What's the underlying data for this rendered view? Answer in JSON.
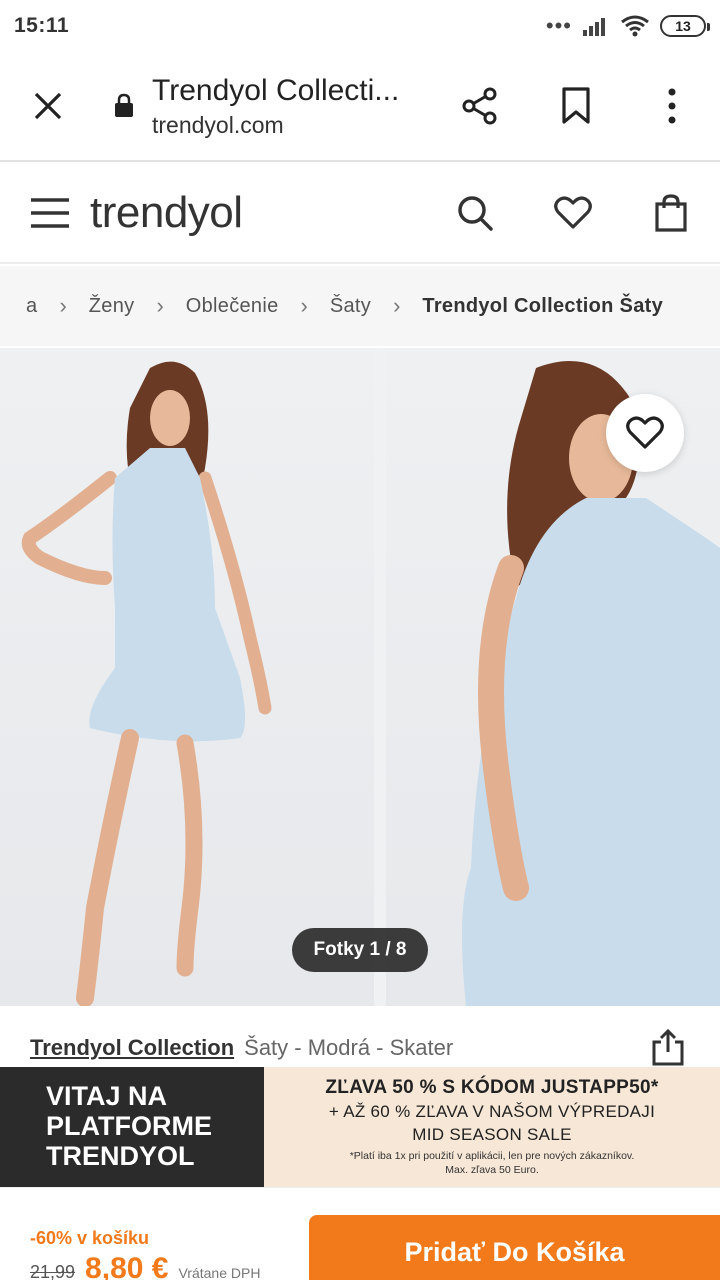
{
  "status": {
    "time": "15:11",
    "battery": "13"
  },
  "browser": {
    "title": "Trendyol Collecti...",
    "domain": "trendyol.com"
  },
  "site": {
    "logo": "trendyol"
  },
  "breadcrumb": {
    "items": [
      "a",
      "Ženy",
      "Oblečenie",
      "Šaty"
    ],
    "current": "Trendyol Collection Šaty"
  },
  "gallery": {
    "counter": "Fotky 1 / 8",
    "dress_color": "#c8dcec"
  },
  "product": {
    "brand": "Trendyol Collection",
    "name": "Šaty - Modrá - Skater"
  },
  "promo": {
    "left_lines": [
      "VITAJ NA",
      "PLATFORME",
      "TRENDYOL"
    ],
    "line1": "ZĽAVA 50 % S KÓDOM JUSTAPP50*",
    "line2": "+ AŽ 60 % ZĽAVA V NAŠOM VÝPREDAJI",
    "line3": "MID SEASON SALE",
    "note1": "*Platí iba 1x pri použití v aplikácii, len pre nových zákazníkov.",
    "note2": "Max. zľava 50 Euro."
  },
  "pricing": {
    "discount": "-60% v košíku",
    "old_price": "21,99",
    "new_price": "8,80 €",
    "vat": "Vrátane DPH",
    "cart_label": "Pridať Do Košíka"
  },
  "colors": {
    "brand_orange": "#f27a1a",
    "banner_dark": "#2b2b2b",
    "banner_light": "#f6e7d6"
  }
}
